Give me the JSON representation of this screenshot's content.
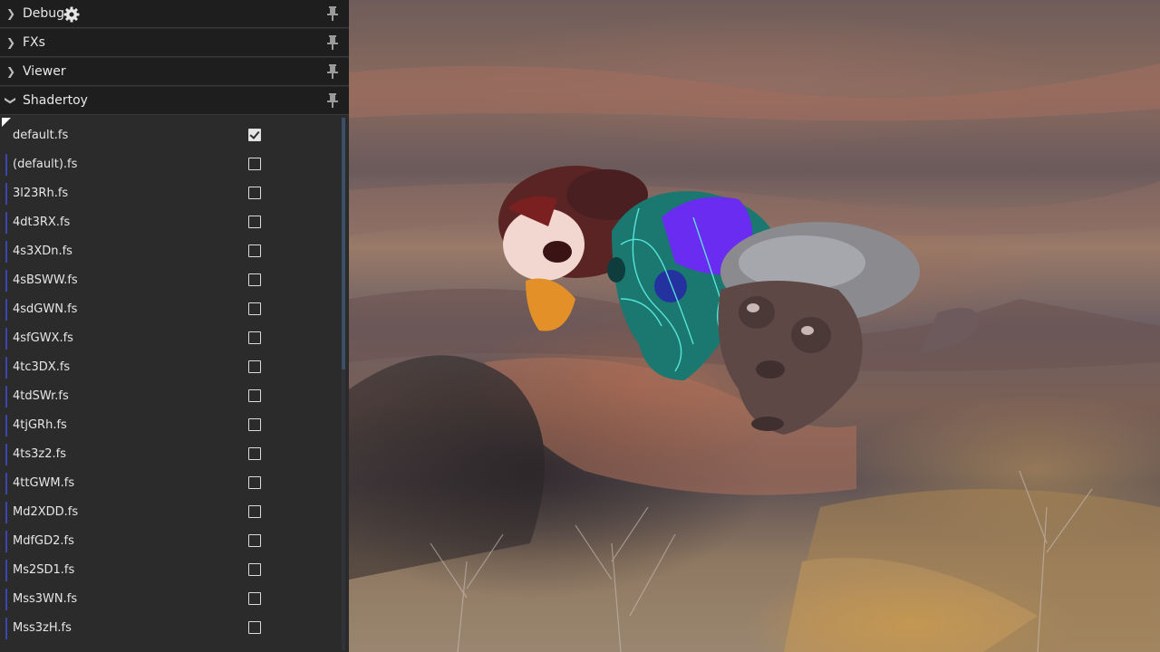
{
  "sections": [
    {
      "label": "Debug",
      "expanded": false,
      "icons": [
        "chevron-right-icon",
        "gear-icon",
        "pin-icon"
      ]
    },
    {
      "label": "FXs",
      "expanded": false,
      "icons": [
        "chevron-right-icon",
        "pin-icon"
      ]
    },
    {
      "label": "Viewer",
      "expanded": false,
      "icons": [
        "chevron-right-icon",
        "pin-icon"
      ]
    },
    {
      "label": "Shadertoy",
      "expanded": true,
      "icons": [
        "chevron-down-icon",
        "pin-icon"
      ]
    }
  ],
  "shadertoy": {
    "items": [
      {
        "name": "default.fs",
        "checked": true
      },
      {
        "name": "(default).fs",
        "checked": false
      },
      {
        "name": "3l23Rh.fs",
        "checked": false
      },
      {
        "name": "4dt3RX.fs",
        "checked": false
      },
      {
        "name": "4s3XDn.fs",
        "checked": false
      },
      {
        "name": "4sBSWW.fs",
        "checked": false
      },
      {
        "name": "4sdGWN.fs",
        "checked": false
      },
      {
        "name": "4sfGWX.fs",
        "checked": false
      },
      {
        "name": "4tc3DX.fs",
        "checked": false
      },
      {
        "name": "4tdSWr.fs",
        "checked": false
      },
      {
        "name": "4tjGRh.fs",
        "checked": false
      },
      {
        "name": "4ts3z2.fs",
        "checked": false
      },
      {
        "name": "4ttGWM.fs",
        "checked": false
      },
      {
        "name": "Md2XDD.fs",
        "checked": false
      },
      {
        "name": "MdfGD2.fs",
        "checked": false
      },
      {
        "name": "Ms2SD1.fs",
        "checked": false
      },
      {
        "name": "Mss3WN.fs",
        "checked": false
      },
      {
        "name": "Mss3zH.fs",
        "checked": false
      }
    ]
  },
  "colors": {
    "panel_bg": "#2b2b2b",
    "header_bg": "#1e1e1e",
    "accent": "#3a47b0",
    "text": "#e6e6e6"
  }
}
